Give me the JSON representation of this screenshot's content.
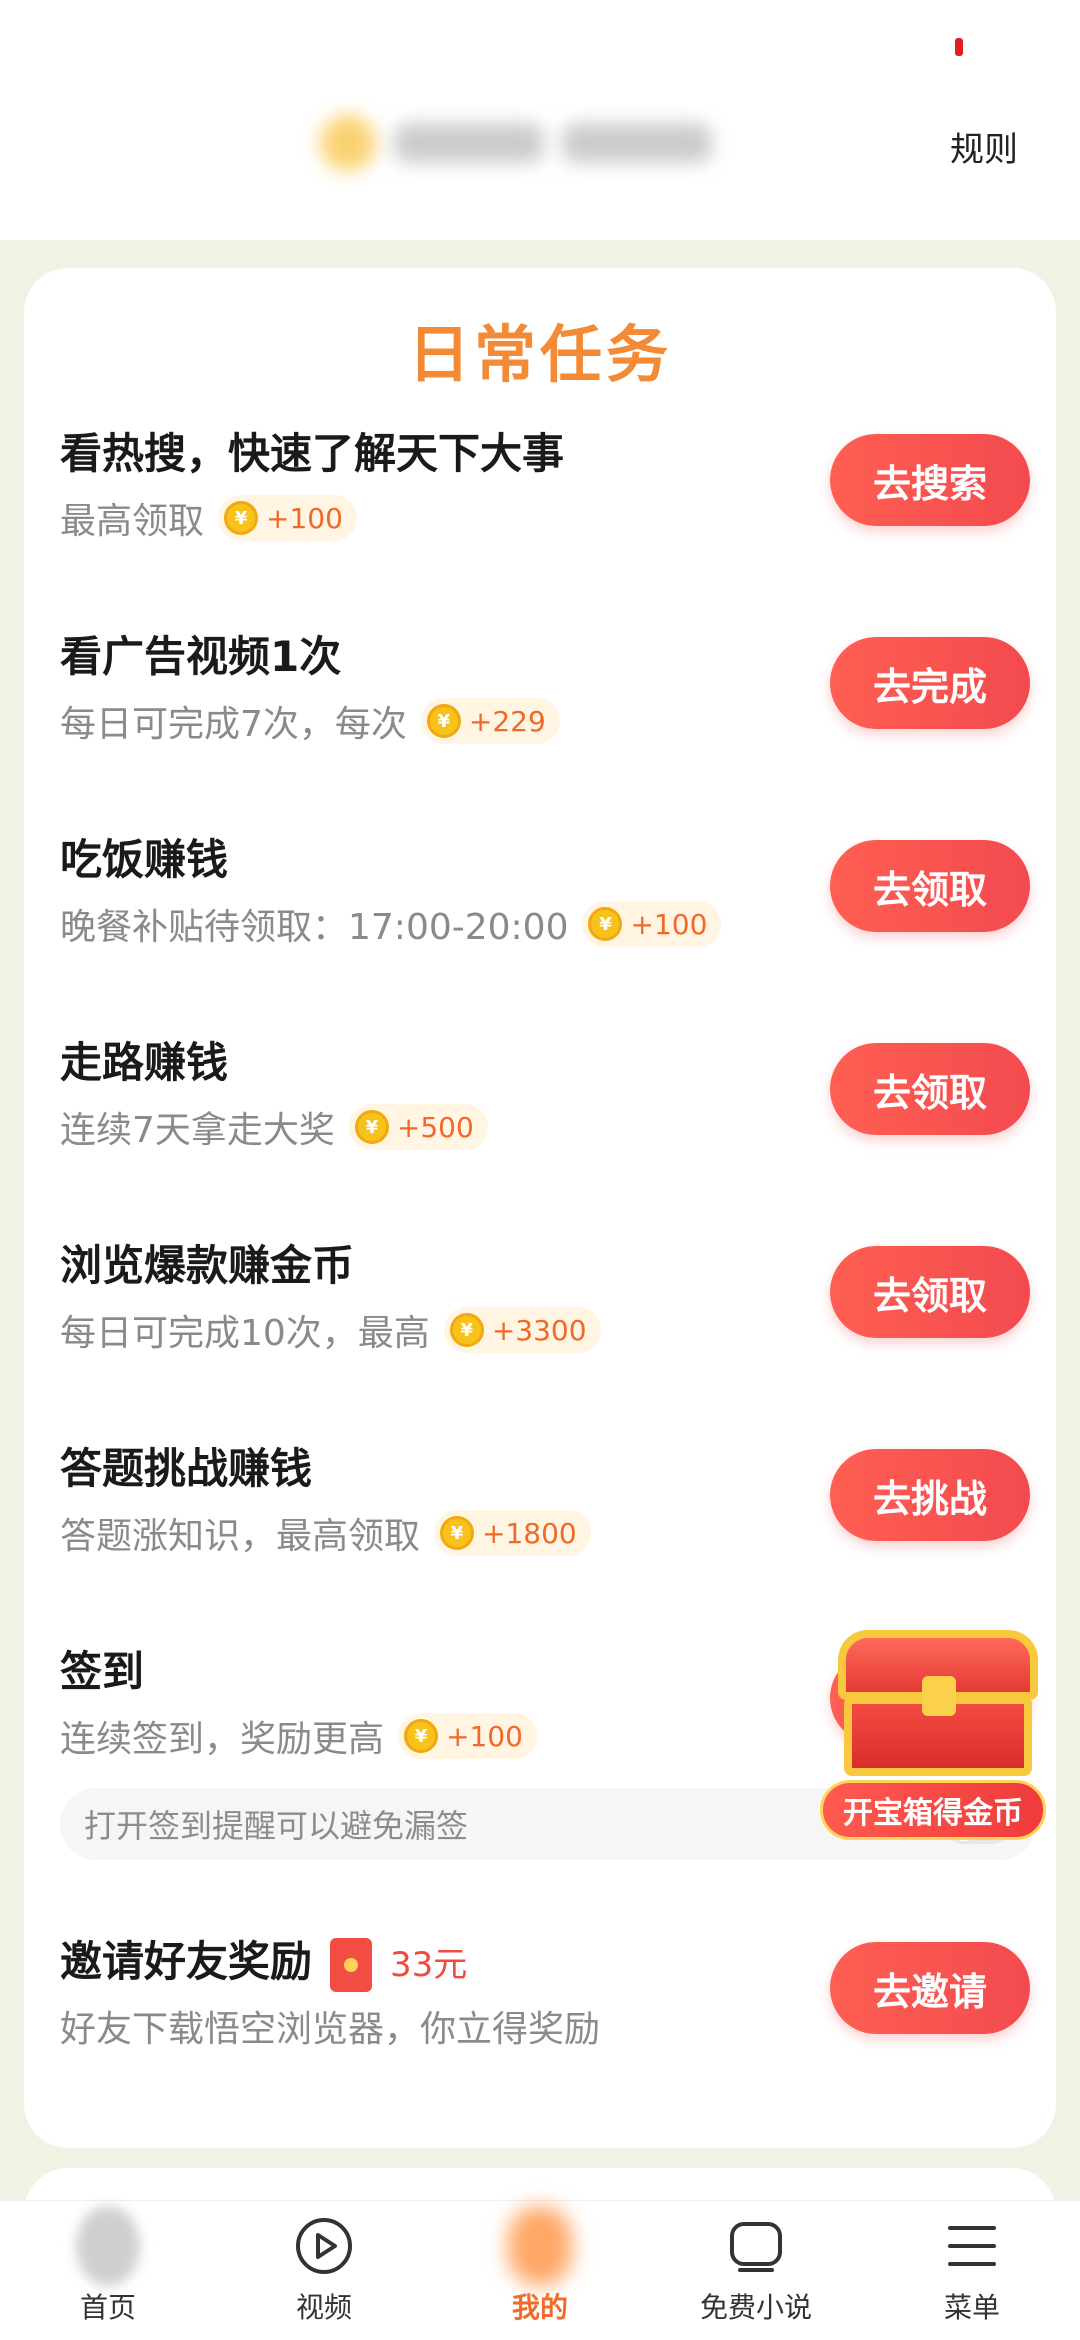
{
  "header": {
    "rules_label": "规则"
  },
  "daily_tasks": {
    "title": "日常任务",
    "coin_glyph": "¥",
    "tasks": [
      {
        "title": "看热搜，快速了解天下大事",
        "subtitle": "最高领取",
        "reward": "+100",
        "button": "去搜索"
      },
      {
        "title": "看广告视频1次",
        "subtitle": "每日可完成7次，每次",
        "reward": "+229",
        "button": "去完成"
      },
      {
        "title": "吃饭赚钱",
        "subtitle": "晚餐补贴待领取：17:00-20:00",
        "reward": "+100",
        "button": "去领取"
      },
      {
        "title": "走路赚钱",
        "subtitle": "连续7天拿走大奖",
        "reward": "+500",
        "button": "去领取"
      },
      {
        "title": "浏览爆款赚金币",
        "subtitle": "每日可完成10次，最高",
        "reward": "+3300",
        "button": "去领取"
      },
      {
        "title": "答题挑战赚钱",
        "subtitle": "答题涨知识，最高领取",
        "reward": "+1800",
        "button": "去挑战"
      },
      {
        "title": "签到",
        "subtitle": "连续签到，奖励更高",
        "reward": "+100",
        "hint": "打开签到提醒可以避免漏签",
        "reminder_toggle": false
      },
      {
        "title": "邀请好友奖励",
        "cash": "33元",
        "subtitle": "好友下载悟空浏览器，你立得奖励",
        "button": "去邀请"
      }
    ]
  },
  "treasure_chest": {
    "label": "开宝箱得金币"
  },
  "bottom_nav": {
    "items": [
      {
        "label": "首页",
        "icon": "home-avatar-icon",
        "active": false
      },
      {
        "label": "视频",
        "icon": "play-circle-icon",
        "active": false
      },
      {
        "label": "我的",
        "icon": "profile-icon",
        "active": true
      },
      {
        "label": "免费小说",
        "icon": "book-icon",
        "active": false
      },
      {
        "label": "菜单",
        "icon": "menu-icon",
        "active": false
      }
    ]
  },
  "colors": {
    "accent": "#f28a36",
    "button": "#f34a4f",
    "background": "#eef3e3",
    "reward_text": "#ef6a2a"
  }
}
